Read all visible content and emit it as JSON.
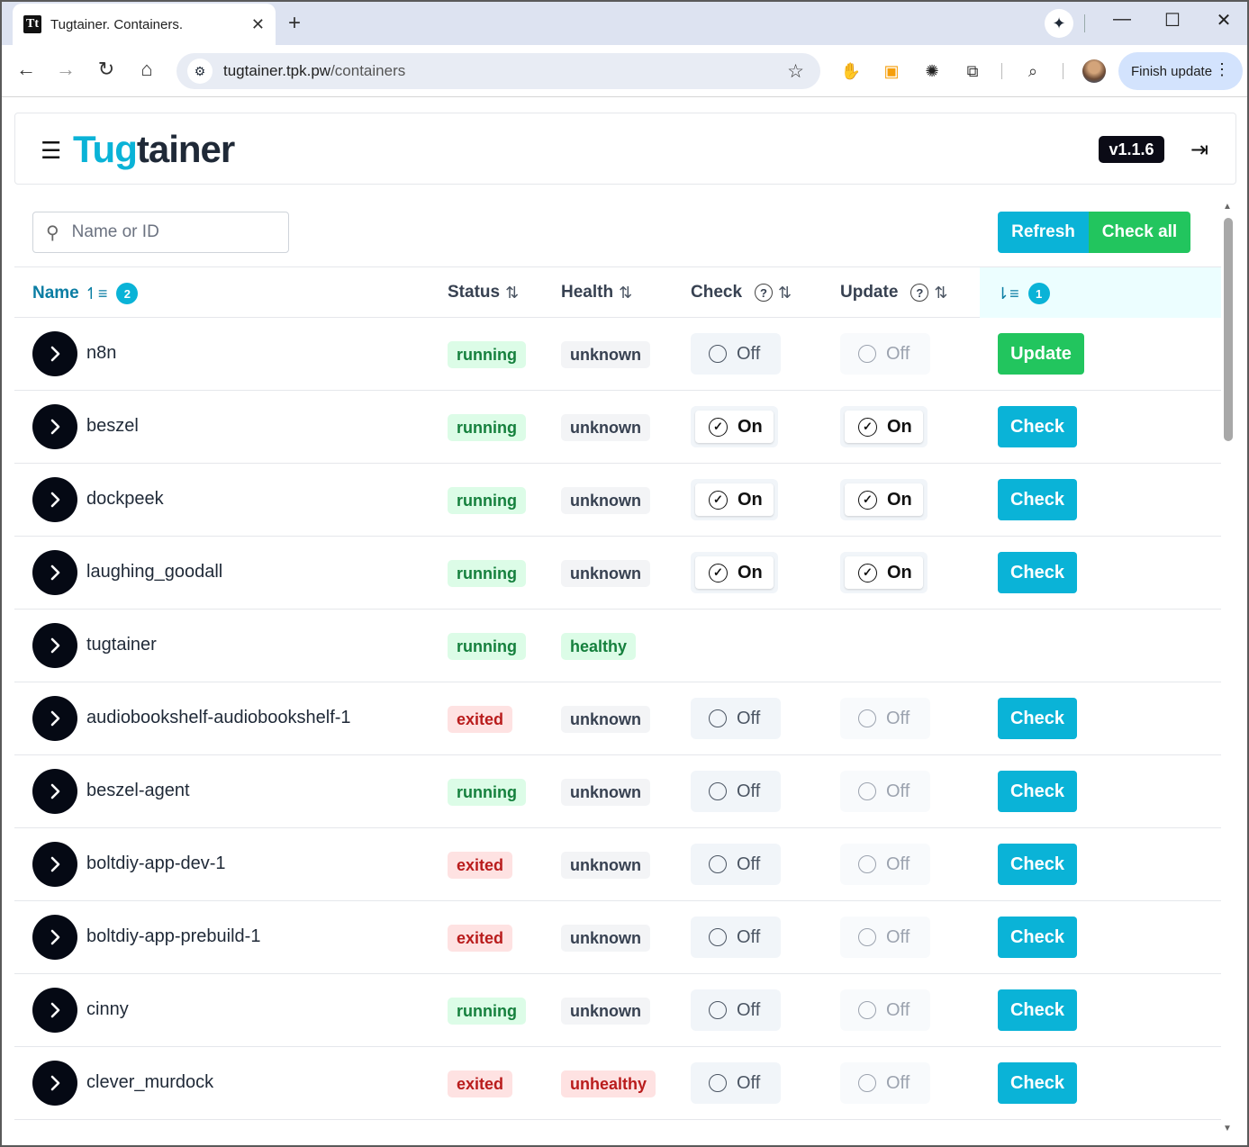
{
  "browser": {
    "tab_title": "Tugtainer. Containers.",
    "favicon_text": "Tt",
    "url_host": "tugtainer.tpk.pw",
    "url_path": "/containers",
    "finish_update_label": "Finish update"
  },
  "app": {
    "logo_part1": "Tug",
    "logo_part2": "tainer",
    "version": "v1.1.6"
  },
  "toolbar": {
    "search_placeholder": "Name or ID",
    "refresh_label": "Refresh",
    "check_all_label": "Check all"
  },
  "table": {
    "headers": {
      "name": "Name",
      "name_sort_badge": "2",
      "status": "Status",
      "health": "Health",
      "check": "Check",
      "update": "Update",
      "actions_sort_badge": "1"
    },
    "rows": [
      {
        "name": "n8n",
        "status": "running",
        "health": "unknown",
        "check": "Off",
        "update": "Off",
        "action": "Update"
      },
      {
        "name": "beszel",
        "status": "running",
        "health": "unknown",
        "check": "On",
        "update": "On",
        "action": "Check"
      },
      {
        "name": "dockpeek",
        "status": "running",
        "health": "unknown",
        "check": "On",
        "update": "On",
        "action": "Check"
      },
      {
        "name": "laughing_goodall",
        "status": "running",
        "health": "unknown",
        "check": "On",
        "update": "On",
        "action": "Check"
      },
      {
        "name": "tugtainer",
        "status": "running",
        "health": "healthy",
        "check": "",
        "update": "",
        "action": ""
      },
      {
        "name": "audiobookshelf-audiobookshelf-1",
        "status": "exited",
        "health": "unknown",
        "check": "Off",
        "update": "Off",
        "action": "Check"
      },
      {
        "name": "beszel-agent",
        "status": "running",
        "health": "unknown",
        "check": "Off",
        "update": "Off",
        "action": "Check"
      },
      {
        "name": "boltdiy-app-dev-1",
        "status": "exited",
        "health": "unknown",
        "check": "Off",
        "update": "Off",
        "action": "Check"
      },
      {
        "name": "boltdiy-app-prebuild-1",
        "status": "exited",
        "health": "unknown",
        "check": "Off",
        "update": "Off",
        "action": "Check"
      },
      {
        "name": "cinny",
        "status": "running",
        "health": "unknown",
        "check": "Off",
        "update": "Off",
        "action": "Check"
      },
      {
        "name": "clever_murdock",
        "status": "exited",
        "health": "unhealthy",
        "check": "Off",
        "update": "Off",
        "action": "Check"
      }
    ]
  },
  "colors": {
    "accent": "#0ab3d7",
    "success": "#22c55e",
    "danger": "#b91c1c"
  }
}
